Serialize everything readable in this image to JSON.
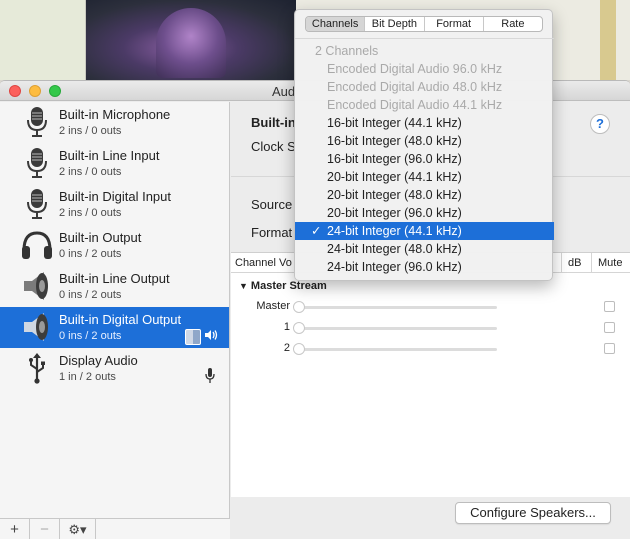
{
  "window": {
    "title": "Aud"
  },
  "sidebar": {
    "devices": [
      {
        "name": "Built-in Microphone",
        "sub": "2 ins / 0 outs",
        "icon": "microphone-icon"
      },
      {
        "name": "Built-in Line Input",
        "sub": "2 ins / 0 outs",
        "icon": "microphone-icon"
      },
      {
        "name": "Built-in Digital Input",
        "sub": "2 ins / 0 outs",
        "icon": "microphone-icon"
      },
      {
        "name": "Built-in Output",
        "sub": "0 ins / 2 outs",
        "icon": "headphones-icon"
      },
      {
        "name": "Built-in Line Output",
        "sub": "0 ins / 2 outs",
        "icon": "speaker-icon"
      },
      {
        "name": "Built-in Digital Output",
        "sub": "0 ins / 2 outs",
        "icon": "speaker-icon",
        "selected": true
      },
      {
        "name": "Display Audio",
        "sub": "1 in / 2 outs",
        "icon": "usb-icon"
      }
    ],
    "bottom": {
      "add": "+",
      "remove": "−",
      "gear": "⚙▾"
    }
  },
  "main": {
    "device_title": "Built-in",
    "clock_label": "Clock S",
    "source_label": "Source",
    "format_label": "Format",
    "help": "?",
    "table": {
      "col_volume": "Channel Vo",
      "col_db": "dB",
      "col_mute": "Mute",
      "group": "Master Stream",
      "rows": [
        {
          "label": "Master"
        },
        {
          "label": "1"
        },
        {
          "label": "2"
        }
      ]
    },
    "configure_button": "Configure Speakers..."
  },
  "popup": {
    "tabs": [
      "Channels",
      "Bit Depth",
      "Format",
      "Rate"
    ],
    "active_tab": "Channels",
    "header": "2 Channels",
    "items": [
      {
        "label": "Encoded Digital Audio 96.0 kHz",
        "disabled": true
      },
      {
        "label": "Encoded Digital Audio 48.0 kHz",
        "disabled": true
      },
      {
        "label": "Encoded Digital Audio 44.1 kHz",
        "disabled": true
      },
      {
        "label": "16-bit Integer (44.1 kHz)"
      },
      {
        "label": "16-bit Integer (48.0 kHz)"
      },
      {
        "label": "16-bit Integer (96.0 kHz)"
      },
      {
        "label": "20-bit Integer (44.1 kHz)"
      },
      {
        "label": "20-bit Integer (48.0 kHz)"
      },
      {
        "label": "20-bit Integer (96.0 kHz)"
      },
      {
        "label": "24-bit Integer (44.1 kHz)",
        "selected": true
      },
      {
        "label": "24-bit Integer (48.0 kHz)"
      },
      {
        "label": "24-bit Integer (96.0 kHz)"
      }
    ],
    "check": "✓"
  },
  "colors": {
    "accent": "#1d6fd8",
    "sidebar": "#f5f5f5",
    "disabled_text": "#a9a9a9"
  }
}
